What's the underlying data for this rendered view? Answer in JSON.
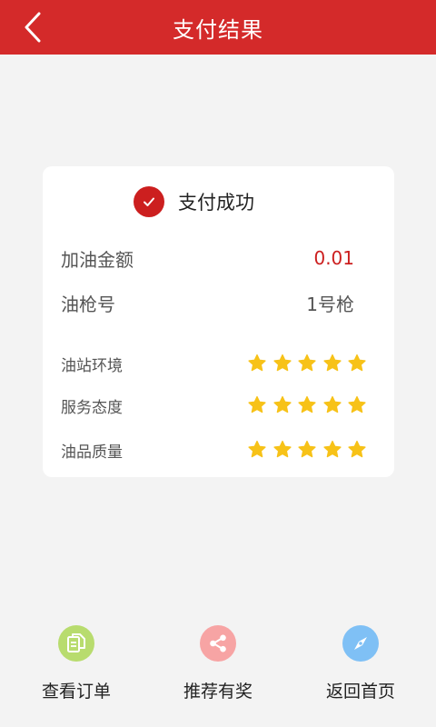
{
  "header": {
    "title": "支付结果",
    "back_icon": "chevron-left-icon"
  },
  "status": {
    "text": "支付成功",
    "icon": "check-circle-icon",
    "color": "#cc1f1f"
  },
  "details": {
    "amount_label": "加油金额",
    "amount_value": "0.01",
    "nozzle_label": "油枪号",
    "nozzle_value": "1号枪"
  },
  "ratings": [
    {
      "label": "油站环境",
      "stars": 5,
      "max": 5
    },
    {
      "label": "服务态度",
      "stars": 5,
      "max": 5
    },
    {
      "label": "油品质量",
      "stars": 5,
      "max": 5
    }
  ],
  "actions": [
    {
      "label": "查看订单",
      "icon": "document-icon",
      "color": "#b8dc6e"
    },
    {
      "label": "推荐有奖",
      "icon": "share-icon",
      "color": "#f7a4a4"
    },
    {
      "label": "返回首页",
      "icon": "compass-icon",
      "color": "#7fc0f5"
    }
  ],
  "colors": {
    "header": "#d42a2a",
    "star": "#f7c218",
    "background": "#f3f3f3"
  }
}
